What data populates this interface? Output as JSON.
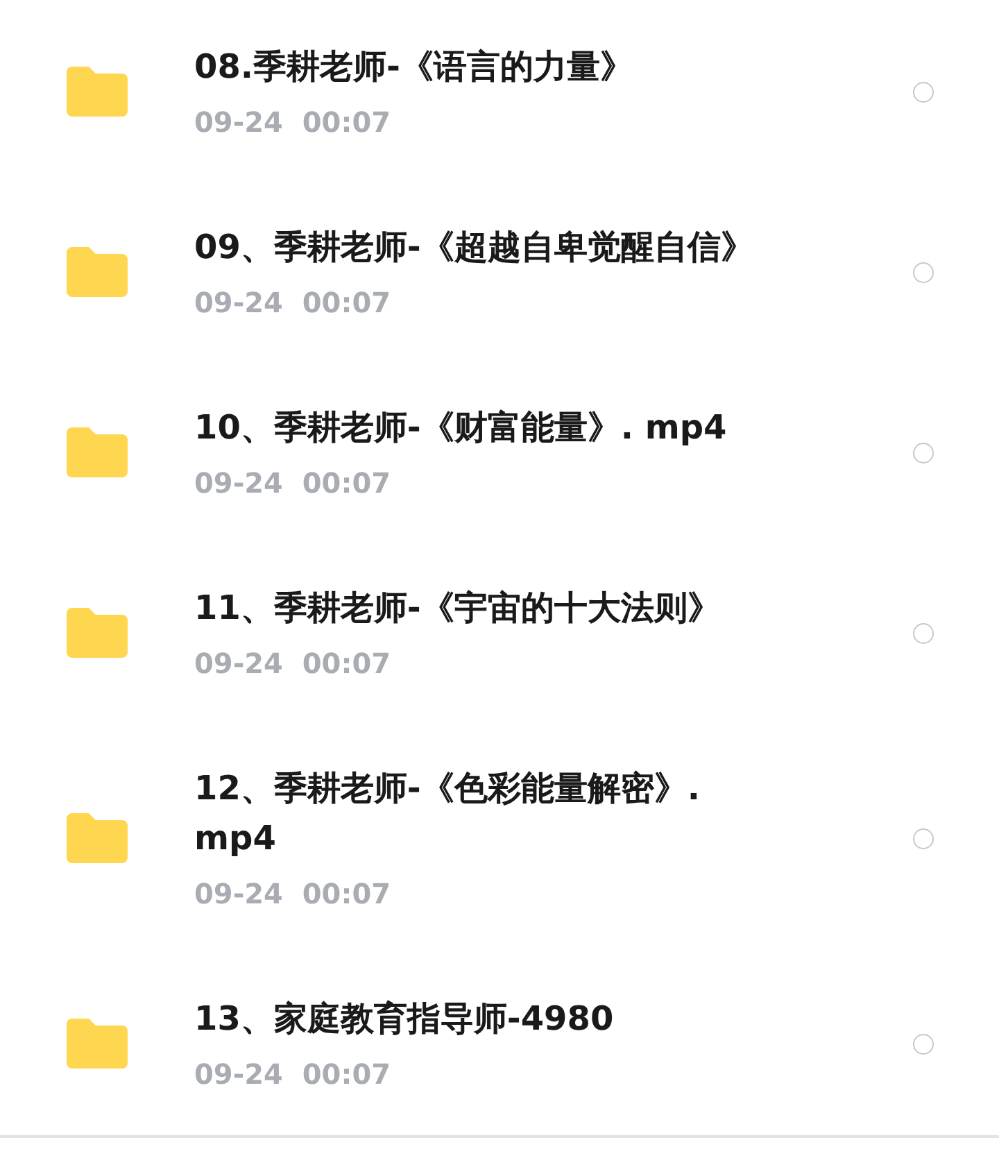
{
  "files": [
    {
      "name": "08.季耕老师-《语言的力量》",
      "date": "09-24  00:07",
      "selected": false
    },
    {
      "name": "09、季耕老师-《超越自卑觉醒自信》",
      "date": "09-24  00:07",
      "selected": false
    },
    {
      "name": "10、季耕老师-《财富能量》. mp4",
      "date": "09-24  00:07",
      "selected": false
    },
    {
      "name": "11、季耕老师-《宇宙的十大法则》",
      "date": "09-24  00:07",
      "selected": false
    },
    {
      "name": "12、季耕老师-《色彩能量解密》. mp4",
      "date": "09-24  00:07",
      "selected": false
    },
    {
      "name": "13、家庭教育指导师-4980",
      "date": "09-24  00:07",
      "selected": false
    }
  ]
}
